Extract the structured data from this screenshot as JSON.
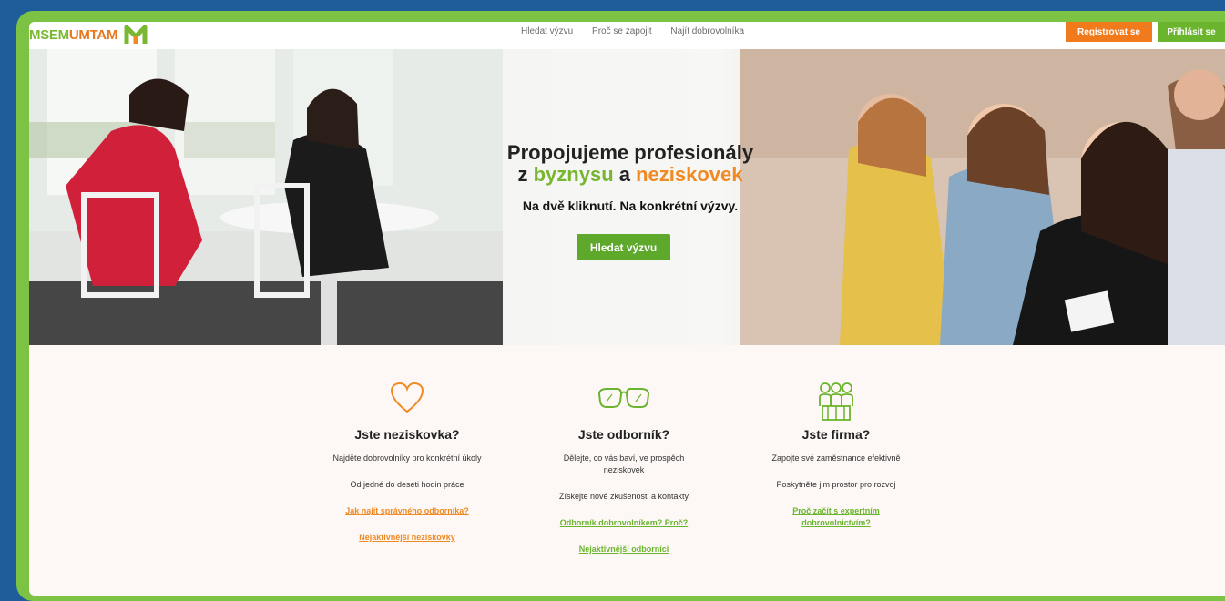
{
  "header": {
    "logo_part1": "MSEM",
    "logo_part2": "UMTAM",
    "nav": [
      "Hledat výzvu",
      "Proč se zapojit",
      "Najít dobrovolníka"
    ],
    "register_label": "Registrovat se",
    "login_label": "Přihlásit se"
  },
  "hero": {
    "headline_line1": "Propojujeme profesionály",
    "headline_z": "z ",
    "headline_business": "byznysu",
    "headline_a": " a ",
    "headline_ngo": "neziskovek",
    "subheadline": "Na dvě kliknutí. Na konkrétní výzvy.",
    "cta_label": "Hledat výzvu"
  },
  "columns": [
    {
      "icon": "heart-icon",
      "title": "Jste neziskovka?",
      "lines": [
        "Najděte dobrovolníky pro konkrétní úkoly",
        "Od jedné do deseti hodin práce"
      ],
      "links": [
        "Jak najít správného odborníka?",
        "Nejaktivnější neziskovky"
      ]
    },
    {
      "icon": "glasses-icon",
      "title": "Jste odborník?",
      "lines": [
        "Dělejte, co vás baví, ve prospěch neziskovek",
        "Získejte nové zkušenosti a kontakty"
      ],
      "links": [
        "Odborník dobrovolníkem? Proč?",
        "Nejaktivnější odborníci"
      ]
    },
    {
      "icon": "team-icon",
      "title": "Jste firma?",
      "lines": [
        "Zapojte své zaměstnance efektivně",
        "Poskytněte jim prostor pro rozvoj"
      ],
      "links": [
        "Proč začít s expertním dobrovolnictvím?"
      ]
    }
  ],
  "colors": {
    "green": "#6bb42e",
    "orange": "#f08a24",
    "frame_blue": "#1f5d9a",
    "frame_green": "#7cc243"
  }
}
